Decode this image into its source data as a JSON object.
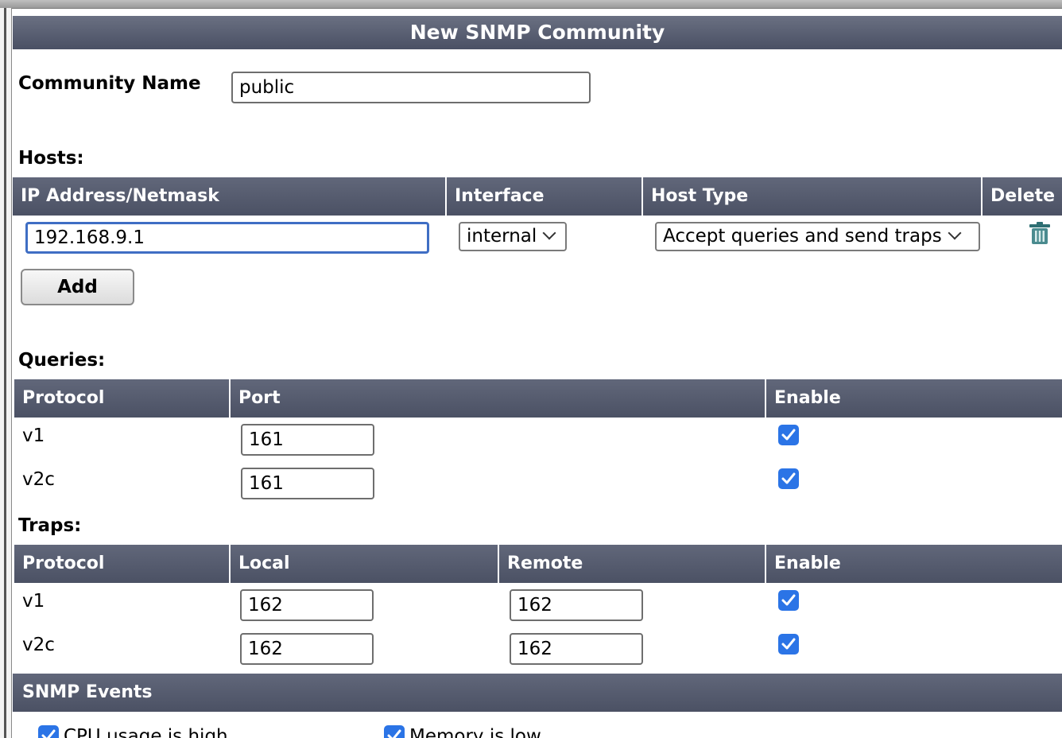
{
  "dialog": {
    "title": "New SNMP Community"
  },
  "community": {
    "label": "Community Name",
    "value": "public"
  },
  "hosts": {
    "heading": "Hosts:",
    "columns": [
      "IP Address/Netmask",
      "Interface",
      "Host Type",
      "Delete"
    ],
    "rows": [
      {
        "ip": "192.168.9.1",
        "interface": "internal",
        "host_type": "Accept queries and send traps",
        "delete_icon": "trash-icon"
      }
    ],
    "add_label": "Add"
  },
  "queries": {
    "heading": "Queries:",
    "columns": [
      "Protocol",
      "Port",
      "Enable"
    ],
    "rows": [
      {
        "protocol": "v1",
        "port": "161",
        "enabled": true
      },
      {
        "protocol": "v2c",
        "port": "161",
        "enabled": true
      }
    ]
  },
  "traps": {
    "heading": "Traps:",
    "columns": [
      "Protocol",
      "Local",
      "Remote",
      "Enable"
    ],
    "rows": [
      {
        "protocol": "v1",
        "local": "162",
        "remote": "162",
        "enabled": true
      },
      {
        "protocol": "v2c",
        "local": "162",
        "remote": "162",
        "enabled": true
      }
    ]
  },
  "events": {
    "heading": "SNMP Events",
    "items": [
      {
        "label": "CPU usage is high",
        "checked": true
      },
      {
        "label": "Memory is low",
        "checked": true
      }
    ]
  },
  "colors": {
    "header_bg": "#555b6e",
    "checkbox": "#2b74e6",
    "focus": "#3f6ec4"
  }
}
